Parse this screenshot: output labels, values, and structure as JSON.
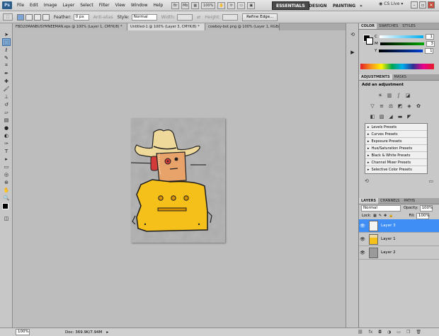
{
  "app": {
    "logo": "Ps"
  },
  "menu": [
    "File",
    "Edit",
    "Image",
    "Layer",
    "Select",
    "Filter",
    "View",
    "Window",
    "Help"
  ],
  "title_icons": [
    "bridge-icon",
    "mini-bridge-icon",
    "zoom-level-icon",
    "grid-icon",
    "screen-mode-icon"
  ],
  "zoom_display": "100%",
  "workspaces": {
    "essentials": "ESSENTIALS",
    "design": "DESIGN",
    "painting": "PAINTING",
    "more": "»"
  },
  "cs_live": "CS Live",
  "options": {
    "feather_label": "Feather:",
    "feather_value": "0 px",
    "anti_alias": "Anti-alias",
    "style_label": "Style:",
    "style_value": "Normal",
    "width_label": "Width:",
    "height_label": "Height:",
    "refine_edge": "Refine Edge..."
  },
  "doc_tabs": [
    "FBD20MANBUSYMNEEMAN.eps @ 100% (Layer 1, CMYK/8) *",
    "Untitled-1 @ 100% (Layer 3, CMYK/8) *",
    "cowboy-bot.png @ 100% (Layer 1, RGB/8)"
  ],
  "status": {
    "zoom": "100%",
    "doc": "Doc: 369.9K/7.94M"
  },
  "color_panel": {
    "tabs": [
      "COLOR",
      "SWATCHES",
      "STYLES"
    ],
    "channels": [
      {
        "label": "C",
        "value": "1"
      },
      {
        "label": "M",
        "value": "3"
      },
      {
        "label": "Y",
        "value": "1"
      }
    ]
  },
  "adjustments_panel": {
    "tabs": [
      "ADJUSTMENTS",
      "MASKS"
    ],
    "heading": "Add an adjustment",
    "presets": [
      "Levels Presets",
      "Curves Presets",
      "Exposure Presets",
      "Hue/Saturation Presets",
      "Black & White Presets",
      "Channel Mixer Presets",
      "Selective Color Presets"
    ]
  },
  "layers_panel": {
    "tabs": [
      "LAYERS",
      "CHANNELS",
      "PATHS"
    ],
    "blend_mode": "Normal",
    "opacity_label": "Opacity:",
    "opacity_value": "100%",
    "lock_label": "Lock:",
    "fill_label": "Fill:",
    "fill_value": "100%",
    "layers": [
      {
        "name": "Layer 3",
        "selected": true
      },
      {
        "name": "Layer 1",
        "selected": false
      },
      {
        "name": "Layer 2",
        "selected": false
      }
    ]
  },
  "colors": {
    "accent": "#3e8ef5",
    "robot_yellow": "#f6c01a",
    "hat": "#eed99a",
    "skin": "#e8a36a"
  }
}
